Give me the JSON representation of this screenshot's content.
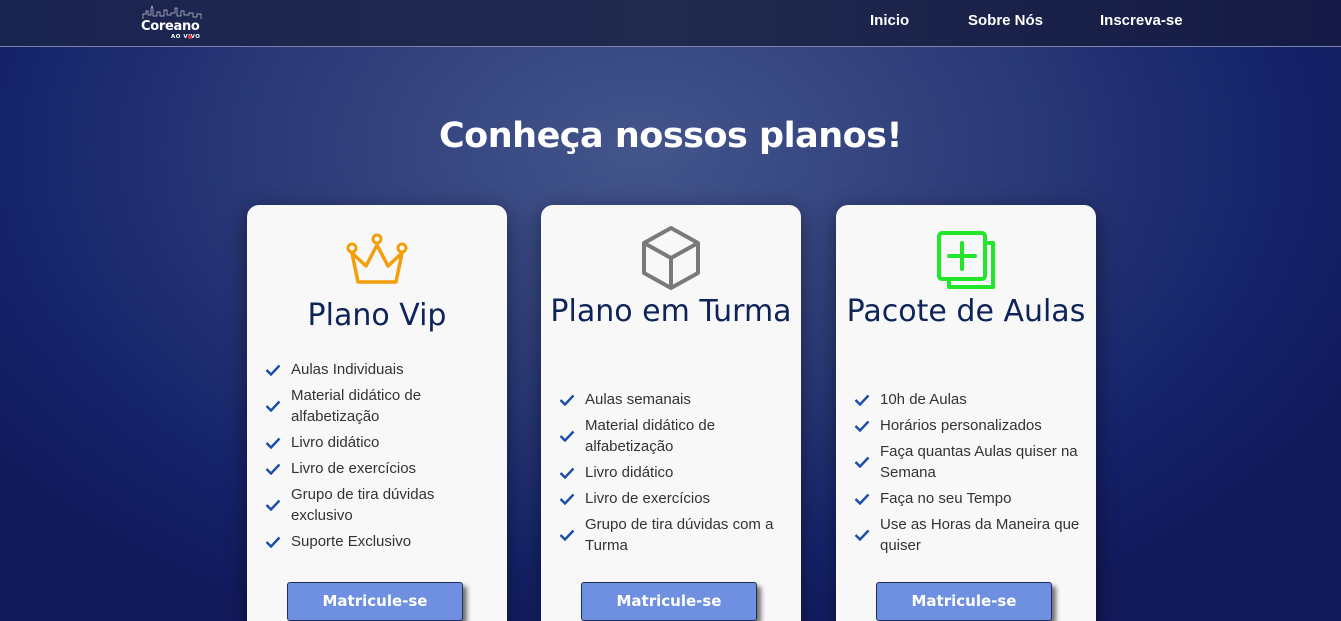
{
  "brand": {
    "name": "Coreano",
    "tagline": "AO VIVO"
  },
  "nav": {
    "items": [
      {
        "label": "Inicio"
      },
      {
        "label": "Sobre Nós"
      },
      {
        "label": "Inscreva-se"
      }
    ]
  },
  "hero": {
    "title": "Conheça nossos planos!"
  },
  "plans": [
    {
      "icon": "crown-icon",
      "icon_color": "#f59e0b",
      "title": "Plano Vip",
      "features": [
        "Aulas Individuais",
        "Material didático de alfabetização",
        "Livro didático",
        "Livro de exercícios",
        "Grupo de tira dúvidas exclusivo",
        "Suporte Exclusivo"
      ],
      "cta": "Matricule-se"
    },
    {
      "icon": "cube-icon",
      "icon_color": "#7a7a7a",
      "title": "Plano em Turma",
      "features": [
        "Aulas semanais",
        "Material didático de alfabetização",
        "Livro didático",
        "Livro de exercícios",
        "Grupo de tira dúvidas com a Turma"
      ],
      "cta": "Matricule-se"
    },
    {
      "icon": "add-copy-icon",
      "icon_color": "#22e62a",
      "title": "Pacote de Aulas",
      "features": [
        "10h de Aulas",
        "Horários personalizados",
        "Faça quantas Aulas quiser na Semana",
        "Faça no seu Tempo",
        "Use as Horas da Maneira que quiser"
      ],
      "cta": "Matricule-se"
    }
  ],
  "colors": {
    "accent": "#6f90e0",
    "title": "#0e2358",
    "check": "#1a4ea8"
  }
}
